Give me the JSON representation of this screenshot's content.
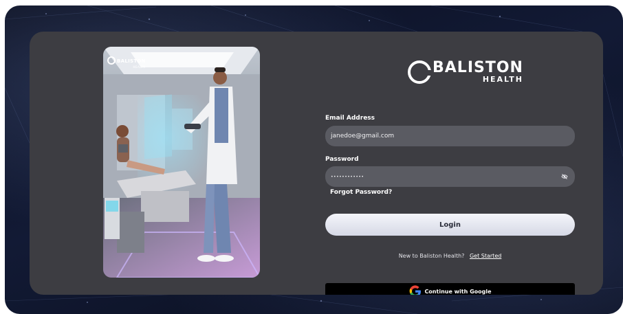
{
  "brand": {
    "name": "BALISTON",
    "sub": "HEALTH"
  },
  "hero": {
    "logo_name": "BALISTON",
    "logo_sub": "HEALTH"
  },
  "form": {
    "email_label": "Email Address",
    "email_value": "janedoe@gmail.com",
    "password_label": "Password",
    "password_value": "••••••••••••",
    "forgot_label": "Forgot Password?",
    "login_label": "Login",
    "signup_prompt": "New to Baliston Health?",
    "signup_link": "Get Started",
    "google_label": "Continue with Google"
  },
  "colors": {
    "card_bg": "#3d3d42",
    "input_bg": "#5a5b62",
    "login_bg": "#e8eaf3",
    "google_bg": "#000000"
  },
  "icons": {
    "password_toggle": "eye-off-icon",
    "google": "google-icon"
  }
}
